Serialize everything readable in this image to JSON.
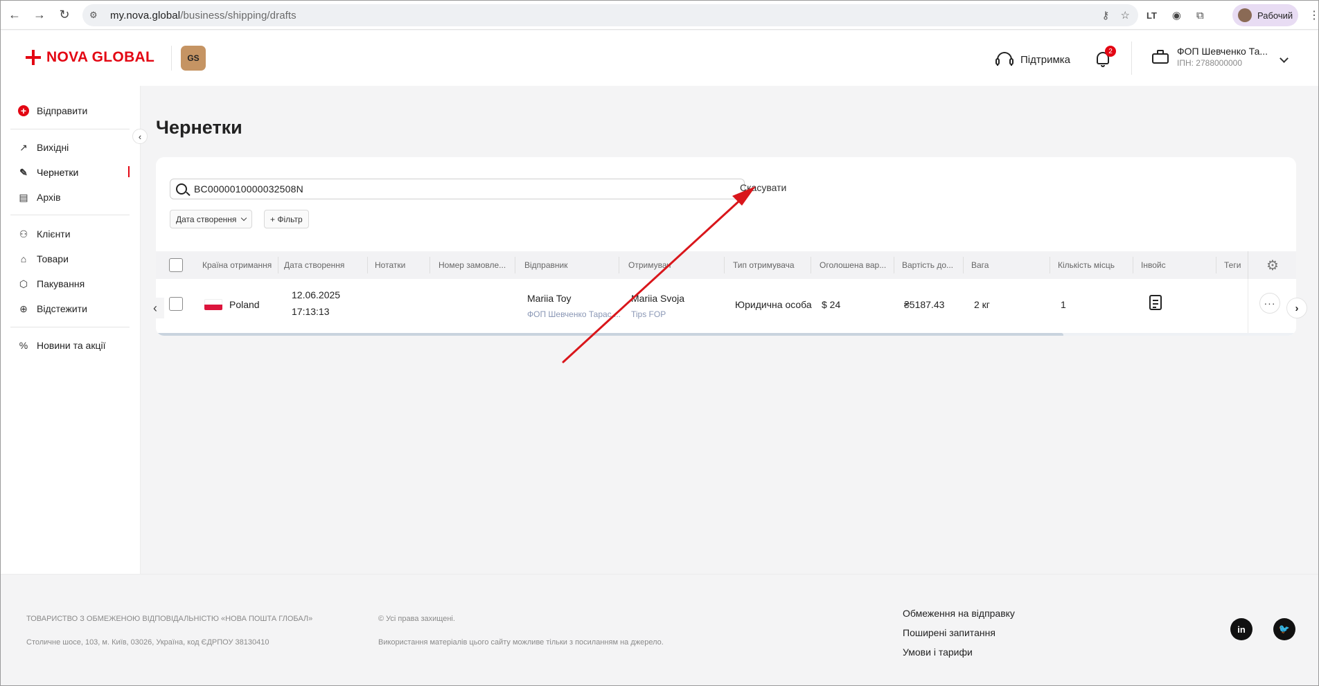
{
  "browser": {
    "url_host": "my.nova.global",
    "url_path": "/business/shipping/drafts",
    "profile_label": "Рабочий"
  },
  "header": {
    "logo_text": "NOVA GLOBAL",
    "gs_badge": "GS",
    "support_label": "Підтримка",
    "notifications_count": "2",
    "account_name": "ФОП Шевченко Та...",
    "account_inn": "ІПН: 2788000000"
  },
  "sidebar": {
    "send": "Відправити",
    "outgoing": "Вихідні",
    "drafts": "Чернетки",
    "archive": "Архів",
    "clients": "Клієнти",
    "goods": "Товари",
    "packaging": "Пакування",
    "tracking": "Відстежити",
    "news": "Новини та акції"
  },
  "main": {
    "title": "Чернетки",
    "search_value": "BC0000010000032508N",
    "cancel_label": "Скасувати",
    "filter_date": "Дата створення",
    "filter_add": "+ Фільтр",
    "columns": [
      "Країна отримання",
      "Дата створення",
      "Нотатки",
      "Номер замовле...",
      "Відправник",
      "Отримувач",
      "Тип отримувача",
      "Оголошена вар...",
      "Вартість до...",
      "Вага",
      "Кількість місць",
      "Інвойс",
      "Теги"
    ],
    "row": {
      "country": "Poland",
      "date": "12.06.2025",
      "time": "17:13:13",
      "sender_name": "Mariia Toy",
      "sender_company": "ФОП Шевченко Тарас ...",
      "recipient_name": "Mariia Svoja",
      "recipient_company": "Tips FOP",
      "recipient_type": "Юридична особа",
      "declared_value": "$ 24",
      "delivery_cost": "₴5187.43",
      "weight": "2 кг",
      "places": "1",
      "more": "···"
    }
  },
  "footer": {
    "company": "ТОВАРИСТВО З ОБМЕЖЕНОЮ ВІДПОВІДАЛЬНІСТЮ «НОВА ПОШТА ГЛОБАЛ»",
    "address": "Столичне шосе, 103, м. Київ, 03026, Україна, код ЄДРПОУ 38130410",
    "rights": "© Усі права захищені.",
    "usage": "Використання матеріалів цього сайту можливе тільки з посиланням на джерело.",
    "links": [
      "Обмеження на відправку",
      "Поширені запитання",
      "Умови і тарифи"
    ],
    "social": [
      "in",
      "🐦"
    ]
  },
  "colors": {
    "brand_red": "#e30613",
    "annotation_arrow": "#d9161b"
  }
}
